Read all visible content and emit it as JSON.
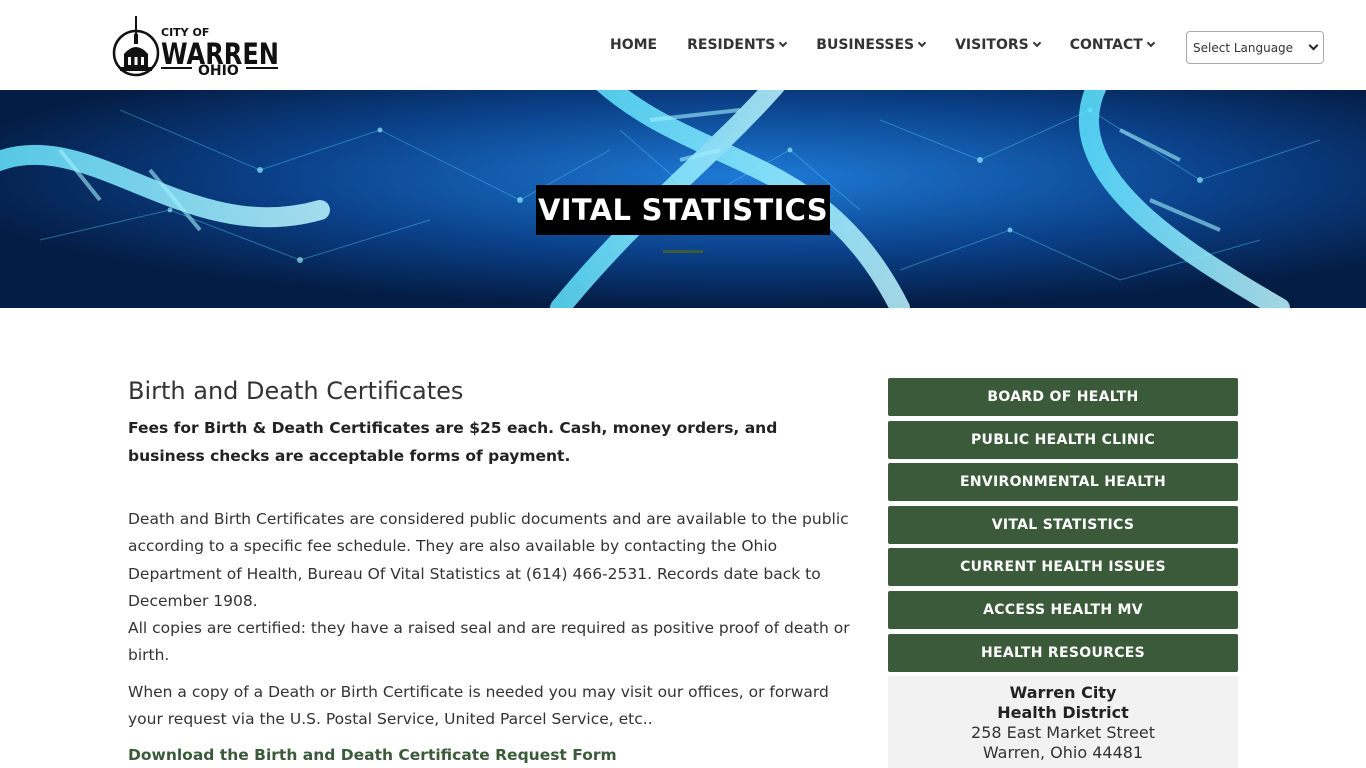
{
  "header": {
    "logo": {
      "top_text": "CITY OF",
      "main_text": "WARREN",
      "sub_text": "OHIO"
    },
    "nav": [
      {
        "label": "HOME",
        "has_dropdown": false,
        "icon": null
      },
      {
        "label": "RESIDENTS",
        "has_dropdown": true,
        "icon": "chevron-down-icon"
      },
      {
        "label": "BUSINESSES",
        "has_dropdown": true,
        "icon": "chevron-down-icon"
      },
      {
        "label": "VISITORS",
        "has_dropdown": true,
        "icon": "chevron-down-icon"
      },
      {
        "label": "CONTACT",
        "has_dropdown": true,
        "icon": "chevron-down-icon"
      }
    ],
    "language_select": {
      "selected": "Select Language"
    }
  },
  "hero": {
    "title": "VITAL STATISTICS"
  },
  "main": {
    "heading": "Birth and Death Certificates",
    "fees": "Fees for Birth & Death Certificates are $25 each. Cash, money orders, and business checks are acceptable forms of payment.",
    "paragraph1": "Death and Birth Certificates are considered public documents and are available to the public according to a specific fee schedule. They are also available by contacting the Ohio Department of Health, Bureau Of Vital Statistics at (614) 466-2531. Records date back to December 1908.",
    "paragraph2": "All copies are certified: they have a raised seal and are required as positive proof of death or birth.",
    "paragraph3": "When a copy of a Death or Birth Certificate is needed you may visit our offices, or forward your request via the U.S. Postal Service, United Parcel Service, etc..",
    "download_link": "Download the Birth and Death Certificate Request Form"
  },
  "sidebar": {
    "buttons": [
      "BOARD OF HEALTH",
      "PUBLIC HEALTH CLINIC",
      "ENVIRONMENTAL HEALTH",
      "VITAL STATISTICS",
      "CURRENT HEALTH ISSUES",
      "ACCESS HEALTH MV",
      "HEALTH RESOURCES"
    ],
    "address": {
      "org_line1": "Warren City",
      "org_line2": "Health District",
      "street": "258 East Market Street",
      "city": "Warren, Ohio 44481"
    }
  },
  "colors": {
    "accent_green": "#3b5a3a",
    "hero_blue": "#062a5c",
    "title_bg": "#000000"
  }
}
